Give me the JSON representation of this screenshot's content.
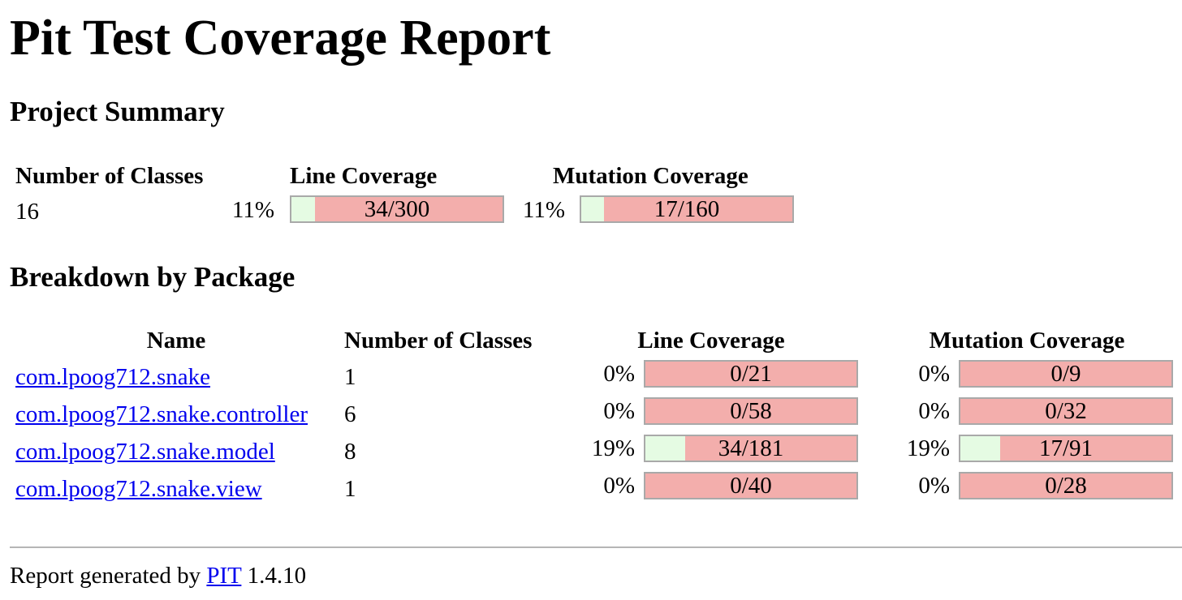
{
  "report": {
    "title": "Pit Test Coverage Report",
    "summary_heading": "Project Summary",
    "breakdown_heading": "Breakdown by Package"
  },
  "summary": {
    "headers": [
      "Number of Classes",
      "Line Coverage",
      "Mutation Coverage"
    ],
    "classes": "16",
    "line": {
      "percent": "11%",
      "ratio": "34/300",
      "fraction": 0.113
    },
    "mutation": {
      "percent": "11%",
      "ratio": "17/160",
      "fraction": 0.106
    }
  },
  "packages": {
    "headers": [
      "Name",
      "Number of Classes",
      "Line Coverage",
      "Mutation Coverage"
    ],
    "rows": [
      {
        "name": "com.lpoog712.snake",
        "classes": "1",
        "line": {
          "percent": "0%",
          "ratio": "0/21",
          "fraction": 0
        },
        "mutation": {
          "percent": "0%",
          "ratio": "0/9",
          "fraction": 0
        }
      },
      {
        "name": "com.lpoog712.snake.controller",
        "classes": "6",
        "line": {
          "percent": "0%",
          "ratio": "0/58",
          "fraction": 0
        },
        "mutation": {
          "percent": "0%",
          "ratio": "0/32",
          "fraction": 0
        }
      },
      {
        "name": "com.lpoog712.snake.model",
        "classes": "8",
        "line": {
          "percent": "19%",
          "ratio": "34/181",
          "fraction": 0.188
        },
        "mutation": {
          "percent": "19%",
          "ratio": "17/91",
          "fraction": 0.187
        }
      },
      {
        "name": "com.lpoog712.snake.view",
        "classes": "1",
        "line": {
          "percent": "0%",
          "ratio": "0/40",
          "fraction": 0
        },
        "mutation": {
          "percent": "0%",
          "ratio": "0/28",
          "fraction": 0
        }
      }
    ]
  },
  "footer": {
    "prefix": "Report generated by",
    "link": "PIT",
    "version": "1.4.10"
  },
  "colors": {
    "covered": "#e5fbe3",
    "uncovered": "#f3aeac",
    "link": "#0000ee"
  }
}
